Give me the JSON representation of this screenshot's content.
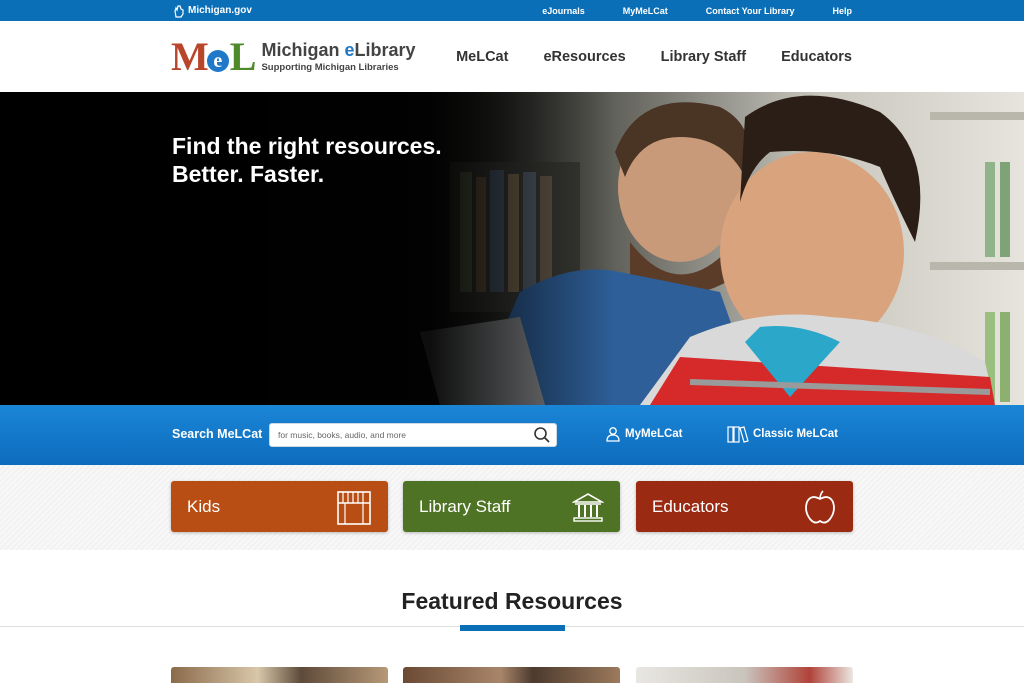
{
  "topbar": {
    "michigan_logo": "Michigan.gov",
    "links": [
      "eJournals",
      "MyMeLCat",
      "Contact Your Library",
      "Help"
    ]
  },
  "header": {
    "logo": {
      "m": "M",
      "e": "e",
      "l": "L"
    },
    "brand_name_prefix": "Michigan ",
    "brand_name_e": "e",
    "brand_name_suffix": "Library",
    "brand_tagline": "Supporting Michigan Libraries",
    "nav": [
      "MeLCat",
      "eResources",
      "Library Staff",
      "Educators"
    ]
  },
  "hero": {
    "line1": "Find the right resources.",
    "line2": "Better. Faster."
  },
  "search": {
    "label": "Search MeLCat",
    "placeholder": "for music, books, audio, and more",
    "mymelcat": "MyMeLCat",
    "classic": "Classic MeLCat",
    "icons": {
      "search": "search-icon",
      "user": "user-icon",
      "books": "books-icon"
    }
  },
  "audience": [
    {
      "label": "Kids",
      "icon": "bookshelf-icon",
      "color": "#b84e14"
    },
    {
      "label": "Library Staff",
      "icon": "library-building-icon",
      "color": "#4e7325"
    },
    {
      "label": "Educators",
      "icon": "apple-icon",
      "color": "#9a2a12"
    }
  ],
  "featured": {
    "title": "Featured Resources",
    "accent_color": "#0b6fb8"
  },
  "colors": {
    "topbar": "#0b6fb8",
    "search_band": "#1b86d6"
  }
}
